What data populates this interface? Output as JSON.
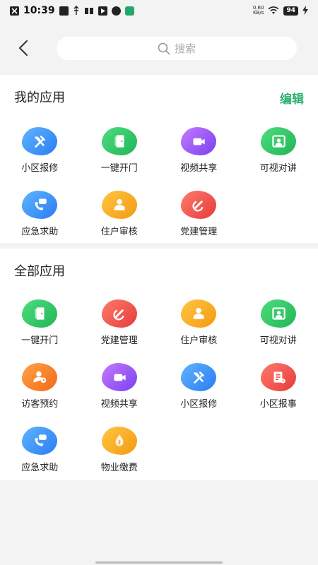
{
  "status_bar": {
    "time": "10:39",
    "net_speed_value": "0.60",
    "net_speed_unit": "KB/s",
    "battery": "94"
  },
  "header": {
    "search_placeholder": "搜索"
  },
  "my_apps": {
    "title": "我的应用",
    "edit_label": "编辑",
    "items": [
      {
        "label": "小区报修",
        "icon": "tools-icon",
        "color": "#3a8ff7"
      },
      {
        "label": "一键开门",
        "icon": "door-icon",
        "color": "#28c062"
      },
      {
        "label": "视频共享",
        "icon": "video-camera-icon",
        "color": "#8f4ff5"
      },
      {
        "label": "可视对讲",
        "icon": "video-intercom-icon",
        "color": "#28c062"
      },
      {
        "label": "应急求助",
        "icon": "emergency-call-icon",
        "color": "#3a8ff7"
      },
      {
        "label": "住户审核",
        "icon": "resident-review-icon",
        "color": "#f5a623"
      },
      {
        "label": "党建管理",
        "icon": "party-emblem-icon",
        "color": "#ea4a44"
      }
    ]
  },
  "all_apps": {
    "title": "全部应用",
    "items": [
      {
        "label": "一键开门",
        "icon": "door-icon",
        "color": "#28c062"
      },
      {
        "label": "党建管理",
        "icon": "party-emblem-icon",
        "color": "#ea4a44"
      },
      {
        "label": "住户审核",
        "icon": "resident-review-icon",
        "color": "#f5a623"
      },
      {
        "label": "可视对讲",
        "icon": "video-intercom-icon",
        "color": "#28c062"
      },
      {
        "label": "访客预约",
        "icon": "visitor-appointment-icon",
        "color": "#f5791e"
      },
      {
        "label": "视频共享",
        "icon": "video-camera-icon",
        "color": "#8f4ff5"
      },
      {
        "label": "小区报修",
        "icon": "tools-icon",
        "color": "#3a8ff7"
      },
      {
        "label": "小区报事",
        "icon": "report-document-icon",
        "color": "#ea4a44"
      },
      {
        "label": "应急求助",
        "icon": "emergency-call-icon",
        "color": "#3a8ff7"
      },
      {
        "label": "物业缴费",
        "icon": "property-payment-icon",
        "color": "#f5a623"
      }
    ]
  }
}
